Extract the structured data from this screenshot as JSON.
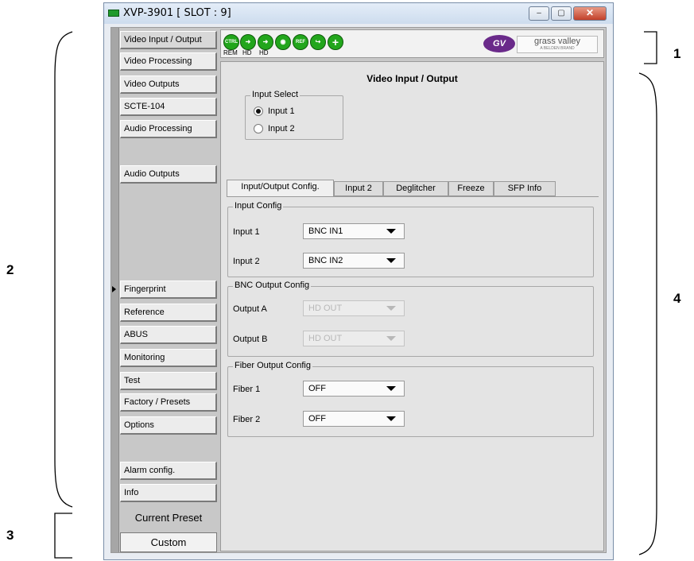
{
  "window": {
    "title": "XVP-3901 [ SLOT : 9]",
    "minimize": "–",
    "maximize": "▢",
    "close": "✕"
  },
  "callouts": [
    "1",
    "2",
    "3",
    "4"
  ],
  "nav": {
    "items": [
      "Video Input / Output",
      "Video Processing",
      "Video Outputs",
      "SCTE-104",
      "Audio Processing",
      "Audio Outputs",
      "Fingerprint",
      "Reference",
      "ABUS",
      "Monitoring",
      "Test",
      "Factory / Presets",
      "Options",
      "Alarm config.",
      "Info"
    ],
    "selected": "Video Input / Output"
  },
  "preset": {
    "label": "Current Preset",
    "value": "Custom"
  },
  "toolbar": {
    "icons": [
      {
        "name": "ctrl-status-icon",
        "glyph": "CTRL"
      },
      {
        "name": "input1-arrow-icon",
        "glyph": "➜"
      },
      {
        "name": "input2-arrow-icon",
        "glyph": "➜"
      },
      {
        "name": "audio-icon",
        "glyph": "◉"
      },
      {
        "name": "ref-icon",
        "glyph": "REF"
      },
      {
        "name": "loop-arrow-icon",
        "glyph": "↪"
      },
      {
        "name": "plus-icon",
        "glyph": "+"
      }
    ],
    "labels": [
      "REM",
      "HD",
      "HD"
    ],
    "logo": {
      "brand": "grass valley",
      "sub": "A BELDEN BRAND",
      "glyph": "GV"
    }
  },
  "page": {
    "title": "Video Input / Output",
    "input_select": {
      "label": "Input Select",
      "options": [
        "Input 1",
        "Input 2"
      ],
      "selected": "Input 1"
    },
    "tabs": [
      "Input/Output Config.",
      "Input 2",
      "Deglitcher",
      "Freeze",
      "SFP Info"
    ],
    "active_tab": "Input/Output Config.",
    "input_config": {
      "label": "Input Config",
      "rows": [
        {
          "label": "Input 1",
          "value": "BNC IN1"
        },
        {
          "label": "Input 2",
          "value": "BNC IN2"
        }
      ]
    },
    "bnc_output_config": {
      "label": "BNC Output Config",
      "rows": [
        {
          "label": "Output A",
          "value": "HD OUT"
        },
        {
          "label": "Output B",
          "value": "HD OUT"
        }
      ]
    },
    "fiber_output_config": {
      "label": "Fiber Output Config",
      "rows": [
        {
          "label": "Fiber 1",
          "value": "OFF"
        },
        {
          "label": "Fiber 2",
          "value": "OFF"
        }
      ]
    }
  }
}
